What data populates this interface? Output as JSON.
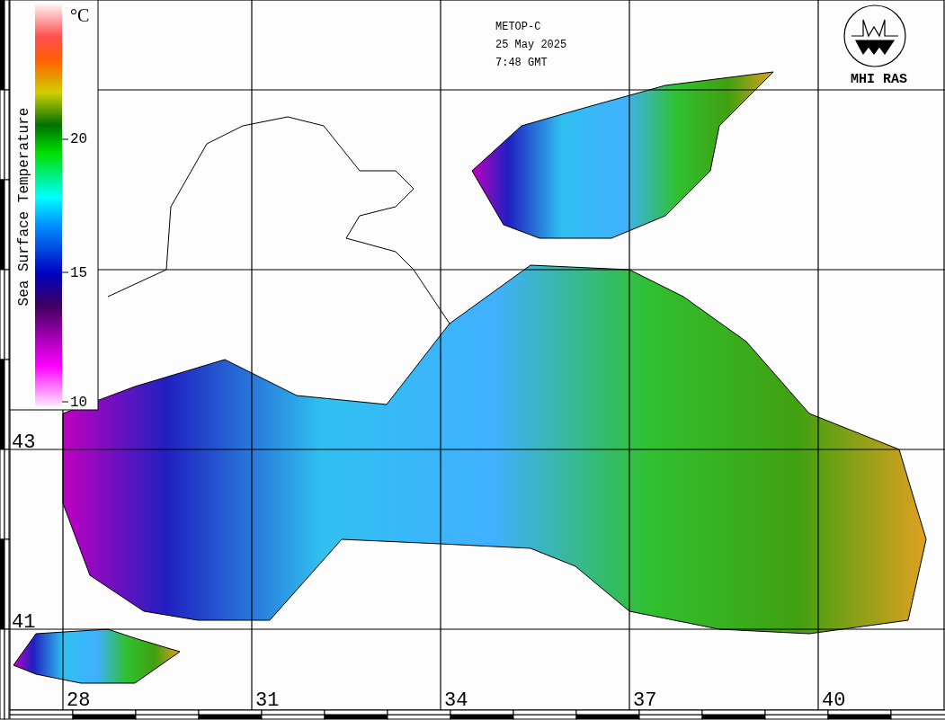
{
  "header": {
    "satellite": "METOP-C",
    "date": "25 May 2025",
    "time": "7:48 GMT"
  },
  "logo": {
    "text": "MHI RAS"
  },
  "colorbar": {
    "unit": "°C",
    "title": "Sea Surface Temperature",
    "ticks": [
      "20",
      "15",
      "10"
    ]
  },
  "map": {
    "latitude_labels": [
      "43",
      "41"
    ],
    "longitude_labels": [
      "28",
      "31",
      "34",
      "37",
      "40"
    ]
  }
}
